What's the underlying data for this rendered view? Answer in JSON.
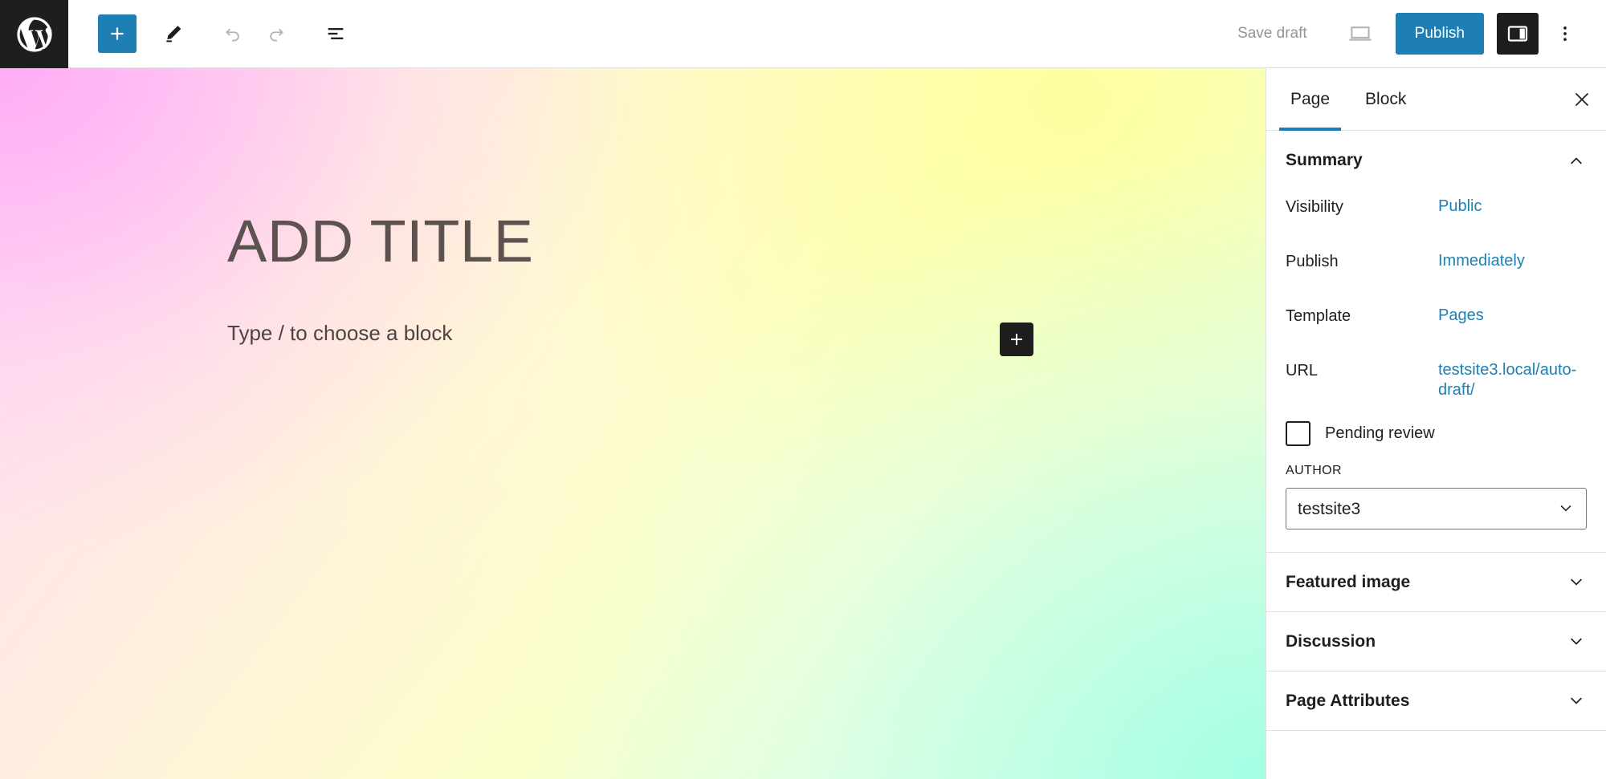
{
  "header": {
    "wp_logo_icon": "wordpress-logo-icon",
    "add_block_label": "+",
    "add_block_icon": "plus-icon",
    "tools_icon": "pencil-icon",
    "undo_icon": "undo-arrow-icon",
    "redo_icon": "redo-arrow-icon",
    "list_view_icon": "document-overview-icon",
    "save_draft_label": "Save draft",
    "preview_icon": "desktop-preview-icon",
    "publish_label": "Publish",
    "settings_icon": "sidebar-panel-icon",
    "more_options_icon": "vertical-ellipsis-icon"
  },
  "canvas": {
    "title": "Add title",
    "block_placeholder": "Type / to choose a block",
    "inserter_icon": "plus-icon"
  },
  "sidebar": {
    "tabs": [
      {
        "label": "Page",
        "active": true
      },
      {
        "label": "Block",
        "active": false
      }
    ],
    "close_icon": "close-x-icon",
    "summary": {
      "title": "Summary",
      "collapse_icon": "chevron-up-icon",
      "rows": [
        {
          "label": "Visibility",
          "value": "Public"
        },
        {
          "label": "Publish",
          "value": "Immediately"
        },
        {
          "label": "Template",
          "value": "Pages"
        },
        {
          "label": "URL",
          "value": "testsite3.local/auto-draft/"
        }
      ],
      "pending_review_label": "Pending review",
      "pending_review_checked": false,
      "author_label": "AUTHOR",
      "author_value": "testsite3",
      "author_options": [
        "testsite3"
      ],
      "select_chevron_icon": "chevron-down-icon"
    },
    "panels": [
      {
        "label": "Featured image",
        "icon": "chevron-down-icon"
      },
      {
        "label": "Discussion",
        "icon": "chevron-down-icon"
      },
      {
        "label": "Page Attributes",
        "icon": "chevron-down-icon"
      }
    ]
  },
  "colors": {
    "accent_blue": "#1d7fb3",
    "link_blue": "#1d7fb3",
    "dark": "#1e1e1e",
    "muted_text": "#949494",
    "border": "#e0e0e0"
  }
}
